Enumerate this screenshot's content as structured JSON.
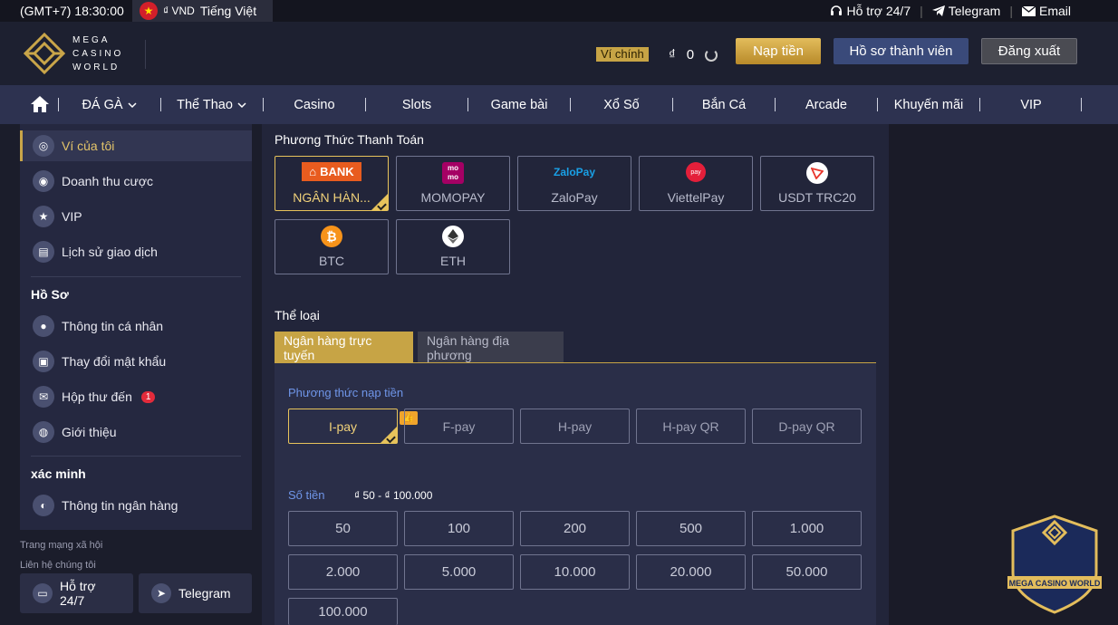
{
  "topbar": {
    "clock": "(GMT+7) 18:30:00",
    "currency": "₫ VND",
    "language": "Tiếng Việt",
    "support": "Hỗ trợ 24/7",
    "telegram": "Telegram",
    "email": "Email"
  },
  "header": {
    "logo_line1": "MEGA",
    "logo_line2": "CASINO",
    "logo_line3": "WORLD",
    "wallet_label": "Ví chính",
    "currency_symbol": "₫",
    "balance": "0",
    "deposit": "Nạp tiền",
    "profile": "Hồ sơ thành viên",
    "logout": "Đăng xuất"
  },
  "nav": {
    "items": [
      "ĐÁ GÀ",
      "Thể Thao",
      "Casino",
      "Slots",
      "Game bài",
      "Xổ Số",
      "Bắn Cá",
      "Arcade",
      "Khuyến mãi",
      "VIP"
    ]
  },
  "sidebar": {
    "wallet": "Ví của tôi",
    "turnover": "Doanh thu cược",
    "vip": "VIP",
    "history": "Lịch sử giao dịch",
    "profile_title": "Hồ Sơ",
    "personal": "Thông tin cá nhân",
    "password": "Thay đổi mật khẩu",
    "inbox": "Hộp thư đến",
    "inbox_count": "1",
    "referral": "Giới thiệu",
    "verify_title": "xác minh",
    "bank_info": "Thông tin ngân hàng",
    "social_title": "Trang mạng xã hội",
    "contact_title": "Liên hệ chúng tôi",
    "support": "Hỗ trợ 24/7",
    "telegram": "Telegram"
  },
  "payment": {
    "title": "Phương Thức Thanh Toán",
    "methods": [
      "NGÂN HÀN...",
      "MOMOPAY",
      "ZaloPay",
      "ViettelPay",
      "USDT TRC20",
      "BTC",
      "ETH"
    ],
    "bank_logo": "BANK",
    "momo_logo": "mo mo",
    "zalo_logo": "ZaloPay",
    "viettel_logo": "pay"
  },
  "category": {
    "title": "Thể loại",
    "tab_online": "Ngân hàng trực tuyến",
    "tab_local": "Ngân hàng địa phương"
  },
  "deposit_method": {
    "title": "Phương thức nạp tiền",
    "options": [
      "I-pay",
      "F-pay",
      "H-pay",
      "H-pay QR",
      "D-pay QR"
    ]
  },
  "amount": {
    "title": "Số tiền",
    "range": "₫ 50 - ₫ 100.000",
    "values": [
      "50",
      "100",
      "200",
      "500",
      "1.000",
      "2.000",
      "5.000",
      "10.000",
      "20.000",
      "50.000",
      "100.000"
    ]
  },
  "watermark": {
    "text": "MEGA CASINO WORLD"
  },
  "colors": {
    "gold": "#c7a445",
    "nav_bg": "#2d3250",
    "panel_bg": "#2a2e48",
    "blue_label": "#6f95e8"
  }
}
